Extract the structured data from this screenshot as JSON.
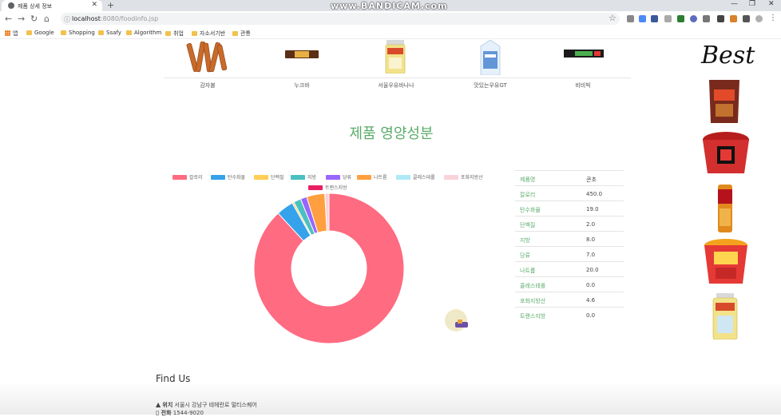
{
  "browser": {
    "tab_title": "제품 상세 정보",
    "url_host": "localhost",
    "url_path": ":8080/foodinfo.jsp",
    "recorder_watermark": "www.BANDICAM.com",
    "bookmarks": [
      "앱",
      "Google",
      "Shopping",
      "Ssafy",
      "Algorithm",
      "취업",
      "자소서기반",
      "관통"
    ]
  },
  "products": [
    "감자불",
    "누크바",
    "서울우유바나나",
    "맛있는우유GT",
    "비비빅"
  ],
  "section_title": "제품 영양성분",
  "chart_data": {
    "type": "doughnut",
    "title": "",
    "legend_position": "top",
    "categories": [
      "칼로리",
      "탄수화물",
      "단백질",
      "지방",
      "당류",
      "나트륨",
      "콜레스테롤",
      "포화지방산",
      "트랜스지방"
    ],
    "values": [
      450.0,
      19.0,
      2.0,
      8.0,
      7.0,
      20.0,
      0.0,
      4.6,
      0.0
    ],
    "colors": [
      "#ff6b81",
      "#36a2eb",
      "#ffce56",
      "#4bc0c0",
      "#9966ff",
      "#ff9f40",
      "#aee9f7",
      "#f9d3d9",
      "#e91e63"
    ]
  },
  "nutrition_table": [
    {
      "name": "제품명",
      "value": "콘초"
    },
    {
      "name": "칼로리",
      "value": "450.0"
    },
    {
      "name": "탄수화물",
      "value": "19.0"
    },
    {
      "name": "단백질",
      "value": "2.0"
    },
    {
      "name": "지방",
      "value": "8.0"
    },
    {
      "name": "당류",
      "value": "7.0"
    },
    {
      "name": "나트륨",
      "value": "20.0"
    },
    {
      "name": "콜레스테롤",
      "value": "0.0"
    },
    {
      "name": "포화지방산",
      "value": "4.6"
    },
    {
      "name": "트랜스지방",
      "value": "0.0"
    }
  ],
  "sidebar": {
    "heading": "Best"
  },
  "footer": {
    "heading": "Find Us",
    "address_label": "위치",
    "address": "서울시 강남구 테헤란로 멀티스퀘어",
    "phone_label": "전화",
    "phone": "1544-9020"
  }
}
